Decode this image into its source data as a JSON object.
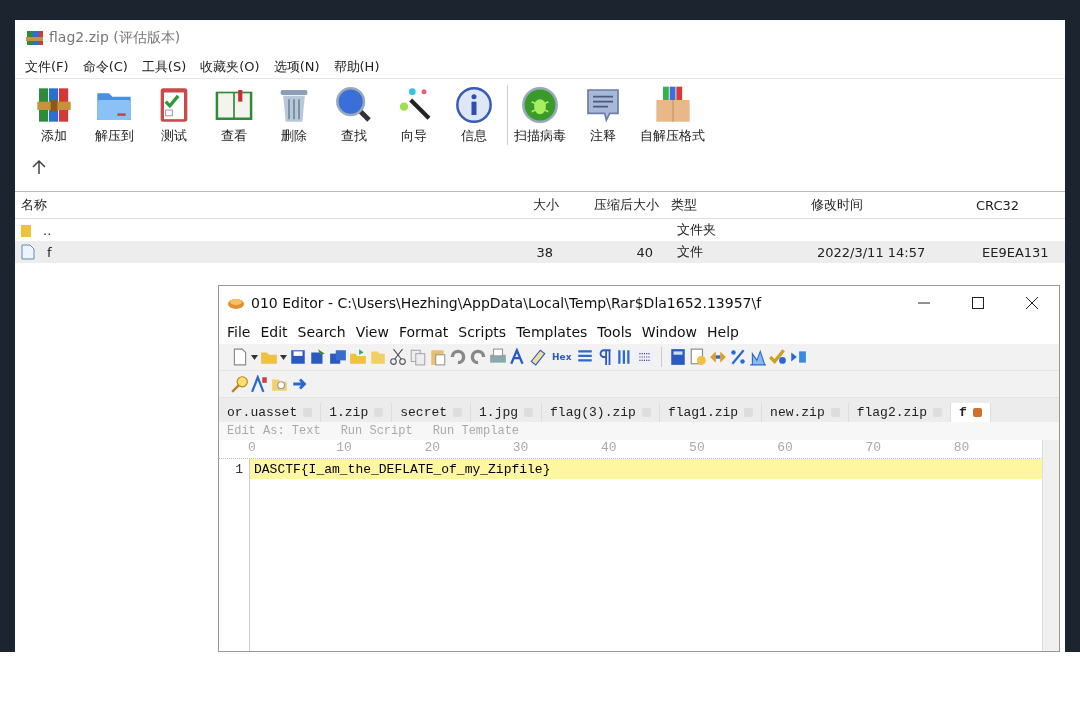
{
  "winrar": {
    "title": "flag2.zip (评估版本)",
    "menu": [
      "文件(F)",
      "命令(C)",
      "工具(S)",
      "收藏夹(O)",
      "选项(N)",
      "帮助(H)"
    ],
    "toolbar": [
      {
        "label": "添加",
        "kind": "books"
      },
      {
        "label": "解压到",
        "kind": "folder"
      },
      {
        "label": "测试",
        "kind": "clipboard"
      },
      {
        "label": "查看",
        "kind": "book"
      },
      {
        "label": "删除",
        "kind": "trash"
      },
      {
        "label": "查找",
        "kind": "magnifier"
      },
      {
        "label": "向导",
        "kind": "wand"
      },
      {
        "label": "信息",
        "kind": "info"
      },
      {
        "label": "扫描病毒",
        "kind": "bug",
        "separated": true
      },
      {
        "label": "注释",
        "kind": "comment"
      },
      {
        "label": "自解压格式",
        "kind": "box"
      }
    ],
    "columns": [
      "名称",
      "大小",
      "压缩后大小",
      "类型",
      "修改时间",
      "CRC32"
    ],
    "rows": [
      {
        "kind": "folder",
        "name": "..",
        "type": "文件夹",
        "selected": false
      },
      {
        "kind": "file",
        "name": "f",
        "size": "38",
        "packed": "40",
        "type": "文件",
        "modified": "2022/3/11 14:57",
        "crc": "EE9EA131",
        "selected": true
      }
    ]
  },
  "editor": {
    "title": "010 Editor - C:\\Users\\Hezhing\\AppData\\Local\\Temp\\Rar$Dla1652.13957\\f",
    "menu": [
      "File",
      "Edit",
      "Search",
      "View",
      "Format",
      "Scripts",
      "Templates",
      "Tools",
      "Window",
      "Help"
    ],
    "tabs": [
      {
        "label": "or.uasset",
        "selected": false
      },
      {
        "label": "1.zip",
        "selected": false
      },
      {
        "label": "secret",
        "selected": false
      },
      {
        "label": "1.jpg",
        "selected": false
      },
      {
        "label": "flag(3).zip",
        "selected": false
      },
      {
        "label": "flag1.zip",
        "selected": false
      },
      {
        "label": "new.zip",
        "selected": false
      },
      {
        "label": "flag2.zip",
        "selected": false
      },
      {
        "label": "f",
        "selected": true
      }
    ],
    "hex_label": "Hex",
    "edit_bar": [
      "Edit As: Text",
      "Run Script",
      "Run Template"
    ],
    "ruler": [
      "0",
      "10",
      "20",
      "30",
      "40",
      "50",
      "60",
      "70",
      "80"
    ],
    "lines": [
      {
        "number": "1",
        "text": "DASCTF{I_am_the_DEFLATE_of_my_Zipfile}",
        "selected": true
      }
    ]
  }
}
